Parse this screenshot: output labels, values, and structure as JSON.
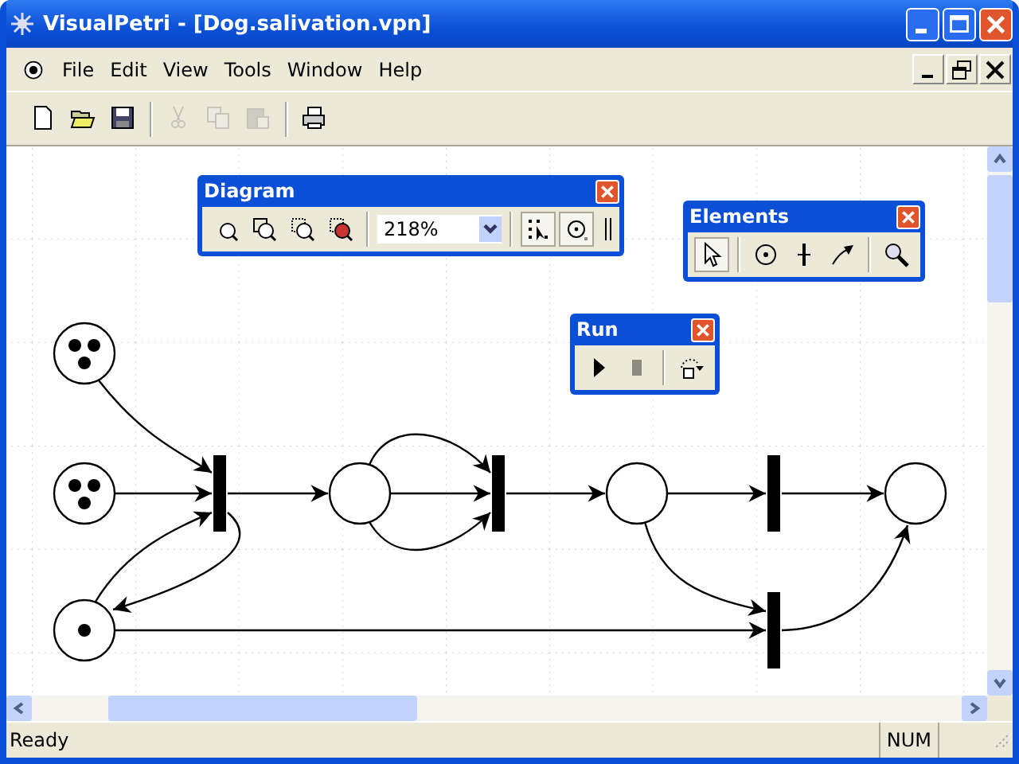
{
  "window": {
    "title": "VisualPetri - [Dog.salivation.vpn]"
  },
  "menu": [
    {
      "label": "File"
    },
    {
      "label": "Edit"
    },
    {
      "label": "View"
    },
    {
      "label": "Tools"
    },
    {
      "label": "Window"
    },
    {
      "label": "Help"
    }
  ],
  "toolbar": {
    "groups": [
      [
        {
          "kind": "new",
          "disabled": false
        },
        {
          "kind": "open",
          "disabled": false
        },
        {
          "kind": "save",
          "disabled": false
        }
      ],
      [
        {
          "kind": "cut",
          "disabled": true
        },
        {
          "kind": "copy",
          "disabled": true
        },
        {
          "kind": "paste",
          "disabled": true
        }
      ],
      [
        {
          "kind": "print",
          "disabled": false
        }
      ]
    ]
  },
  "diagram_toolbar": {
    "title": "Diagram",
    "zoom": "218%",
    "buttons": [
      {
        "kind": "zoom-fit",
        "pressed": false
      },
      {
        "kind": "zoom-pages",
        "pressed": false
      },
      {
        "kind": "zoom-selection",
        "pressed": false
      },
      {
        "kind": "zoom-object",
        "pressed": false
      }
    ],
    "toggles": [
      {
        "kind": "snap-grid",
        "pressed": true
      },
      {
        "kind": "center",
        "pressed": true
      }
    ]
  },
  "elements_toolbar": {
    "title": "Elements",
    "tools": [
      {
        "kind": "pointer",
        "selected": true
      },
      {
        "kind": "place",
        "selected": false
      },
      {
        "kind": "transition",
        "selected": false
      },
      {
        "kind": "arc",
        "selected": false
      },
      {
        "kind": "magnifier",
        "selected": false
      }
    ]
  },
  "run_toolbar": {
    "title": "Run",
    "controls": [
      {
        "kind": "play",
        "disabled": false
      },
      {
        "kind": "stop",
        "disabled": true
      },
      {
        "kind": "step-menu",
        "disabled": false
      }
    ]
  },
  "net": {
    "places": [
      {
        "tokens": [
          {
            "kind": "token"
          },
          {
            "kind": "token"
          },
          {
            "kind": "token"
          }
        ]
      },
      {
        "tokens": [
          {
            "kind": "token"
          },
          {
            "kind": "token"
          },
          {
            "kind": "token"
          }
        ]
      },
      {
        "tokens": [
          {
            "kind": "token"
          }
        ]
      }
    ]
  },
  "status_bar": {
    "text": "Ready",
    "indicators": [
      {
        "label": "NUM"
      }
    ]
  }
}
